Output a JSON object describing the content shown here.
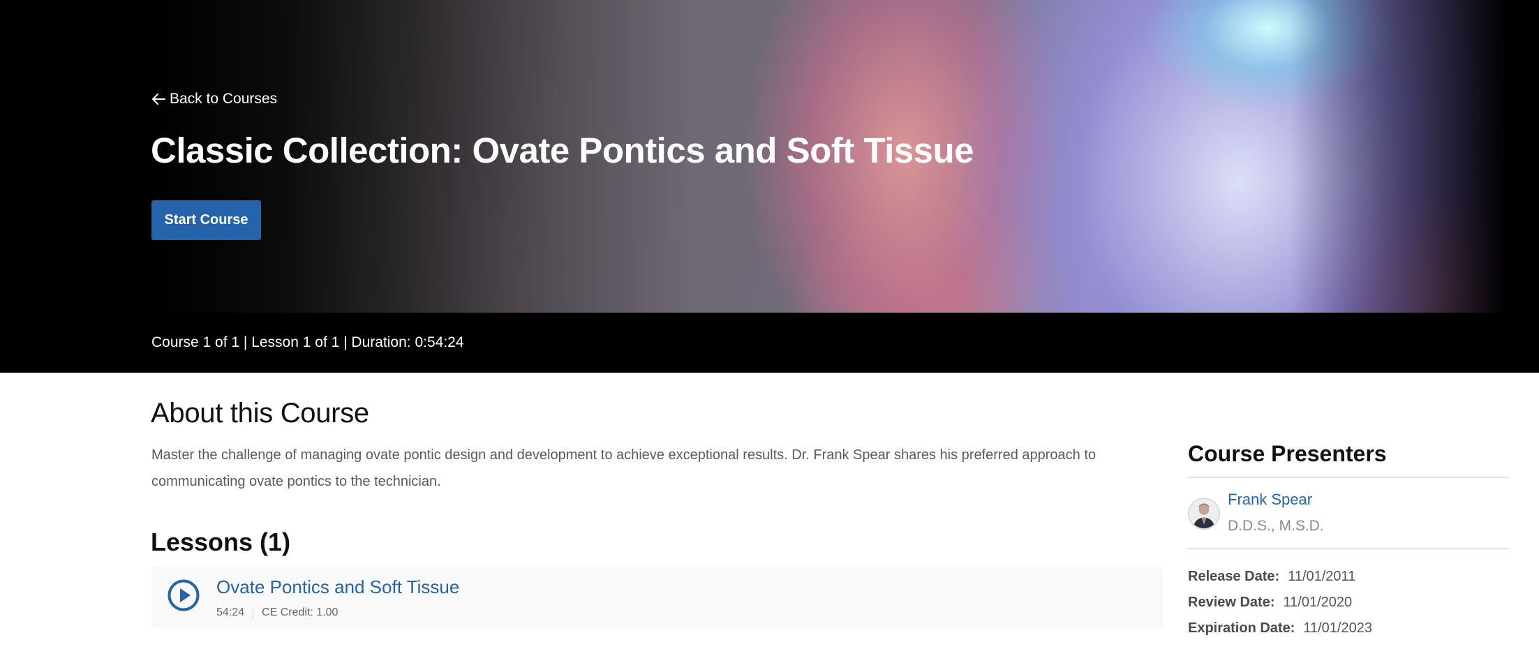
{
  "hero": {
    "back_link": "Back to Courses",
    "title": "Classic Collection: Ovate Pontics and Soft Tissue",
    "start_button": "Start Course",
    "meta": "Course 1 of 1 | Lesson 1 of 1 | Duration: 0:54:24"
  },
  "about": {
    "heading": "About this Course",
    "description": "Master the challenge of managing ovate pontic design and development to achieve exceptional results. Dr. Frank Spear shares his preferred approach to communicating ovate pontics to the technician."
  },
  "lessons": {
    "heading": "Lessons (1)",
    "items": [
      {
        "title": "Ovate Pontics and Soft Tissue",
        "duration": "54:24",
        "credit": "CE Credit: 1.00",
        "icon": "play-circle-icon"
      }
    ]
  },
  "sidebar": {
    "heading": "Course Presenters",
    "presenters": [
      {
        "name": "Frank Spear",
        "credentials": "D.D.S., M.S.D."
      }
    ],
    "dates": [
      {
        "label": "Release Date:",
        "value": "11/01/2011"
      },
      {
        "label": "Review Date:",
        "value": "11/01/2020"
      },
      {
        "label": "Expiration Date:",
        "value": "11/01/2023"
      }
    ]
  },
  "colors": {
    "accent": "#2563ac",
    "hero_background": "#000000",
    "lesson_card_background": "#f9f9f9"
  }
}
